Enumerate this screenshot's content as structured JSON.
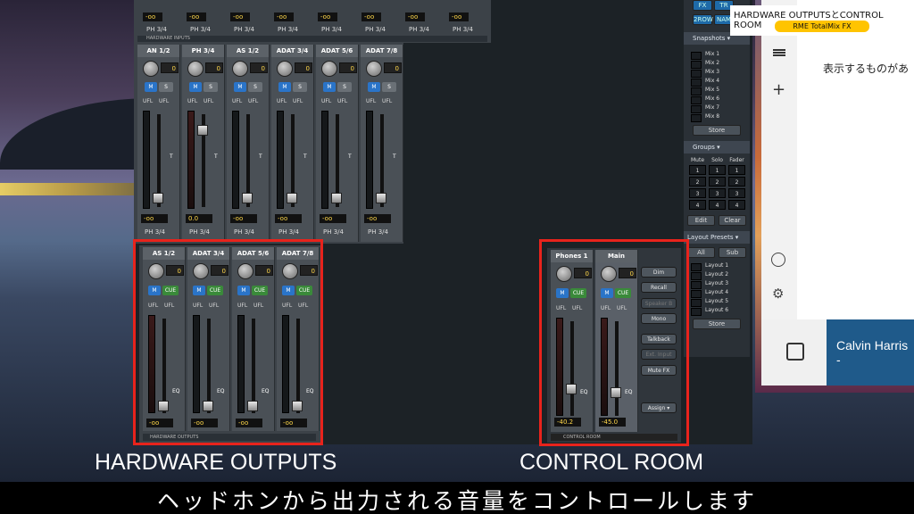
{
  "captions": {
    "hardware_outputs": "HARDWARE OUTPUTS",
    "control_room": "CONTROL ROOM",
    "subtitle": "ヘッドホンから出力される音量をコントロールします"
  },
  "tooltip": {
    "title": "HARDWARE OUTPUTSとCONTROL ROOM",
    "badge": "RME TotalMix FX"
  },
  "top_row": {
    "values": [
      "-oo",
      "-oo",
      "-oo",
      "-oo",
      "-oo",
      "-oo",
      "-oo",
      "-oo"
    ],
    "ph_labels": [
      "PH 3/4",
      "PH 3/4",
      "PH 3/4",
      "PH 3/4",
      "PH 3/4",
      "PH 3/4",
      "PH 3/4",
      "PH 3/4"
    ],
    "section_label": "HARDWARE INPUTS"
  },
  "inputs": [
    {
      "name": "AN 1/2",
      "gain": "0",
      "value": "-oo",
      "ph": "PH 3/4"
    },
    {
      "name": "PH 3/4",
      "gain": "0",
      "value": "0.0",
      "ph": "PH 3/4"
    },
    {
      "name": "AS 1/2",
      "gain": "0",
      "value": "-oo",
      "ph": "PH 3/4"
    },
    {
      "name": "ADAT 3/4",
      "gain": "0",
      "value": "-oo",
      "ph": "PH 3/4"
    },
    {
      "name": "ADAT 5/6",
      "gain": "0",
      "value": "-oo",
      "ph": "PH 3/4"
    },
    {
      "name": "ADAT 7/8",
      "gain": "0",
      "value": "-oo",
      "ph": "PH 3/4"
    }
  ],
  "inputs_common": {
    "m": "M",
    "s": "S",
    "ufl": "UFL",
    "t": "T"
  },
  "outputs": [
    {
      "name": "AS 1/2",
      "gain": "0",
      "value": "-oo"
    },
    {
      "name": "ADAT 3/4",
      "gain": "0",
      "value": "-oo"
    },
    {
      "name": "ADAT 5/6",
      "gain": "0",
      "value": "-oo"
    },
    {
      "name": "ADAT 7/8",
      "gain": "0",
      "value": "-oo"
    }
  ],
  "outputs_common": {
    "m": "M",
    "cue": "CUE",
    "ufl": "UFL",
    "eq": "EQ",
    "section_label": "HARDWARE OUTPUTS"
  },
  "control_room": {
    "channels": [
      {
        "name": "Phones 1",
        "gain": "0",
        "value": "-40.2"
      },
      {
        "name": "Main",
        "gain": "0",
        "value": "-45.0"
      }
    ],
    "buttons": [
      "Dim",
      "Recall",
      "Speaker B",
      "Mono",
      "Talkback",
      "Ext. Input",
      "Mute FX",
      "Assign ▾"
    ],
    "section_label": "CONTROL ROOM"
  },
  "sidebar": {
    "top_buttons": [
      "FX",
      "TR",
      "2ROW",
      "NAM"
    ],
    "snapshots_header": "Snapshots ▾",
    "mixes": [
      "Mix 1",
      "Mix 2",
      "Mix 3",
      "Mix 4",
      "Mix 5",
      "Mix 6",
      "Mix 7",
      "Mix 8"
    ],
    "store": "Store",
    "groups_header": "Groups ▾",
    "groups_cols": [
      "Mute",
      "Solo",
      "Fader"
    ],
    "groups_rows": [
      [
        "1",
        "1",
        "1"
      ],
      [
        "2",
        "2",
        "2"
      ],
      [
        "3",
        "3",
        "3"
      ],
      [
        "4",
        "4",
        "4"
      ]
    ],
    "edit": "Edit",
    "clear": "Clear",
    "layout_header": "Layout Presets ▾",
    "all": "All",
    "sub": "Sub",
    "layouts": [
      "Layout 1",
      "Layout 2",
      "Layout 3",
      "Layout 4",
      "Layout 5",
      "Layout 6"
    ],
    "store2": "Store"
  },
  "window": {
    "text": "表示するものがあ",
    "player": "Calvin Harris -"
  }
}
